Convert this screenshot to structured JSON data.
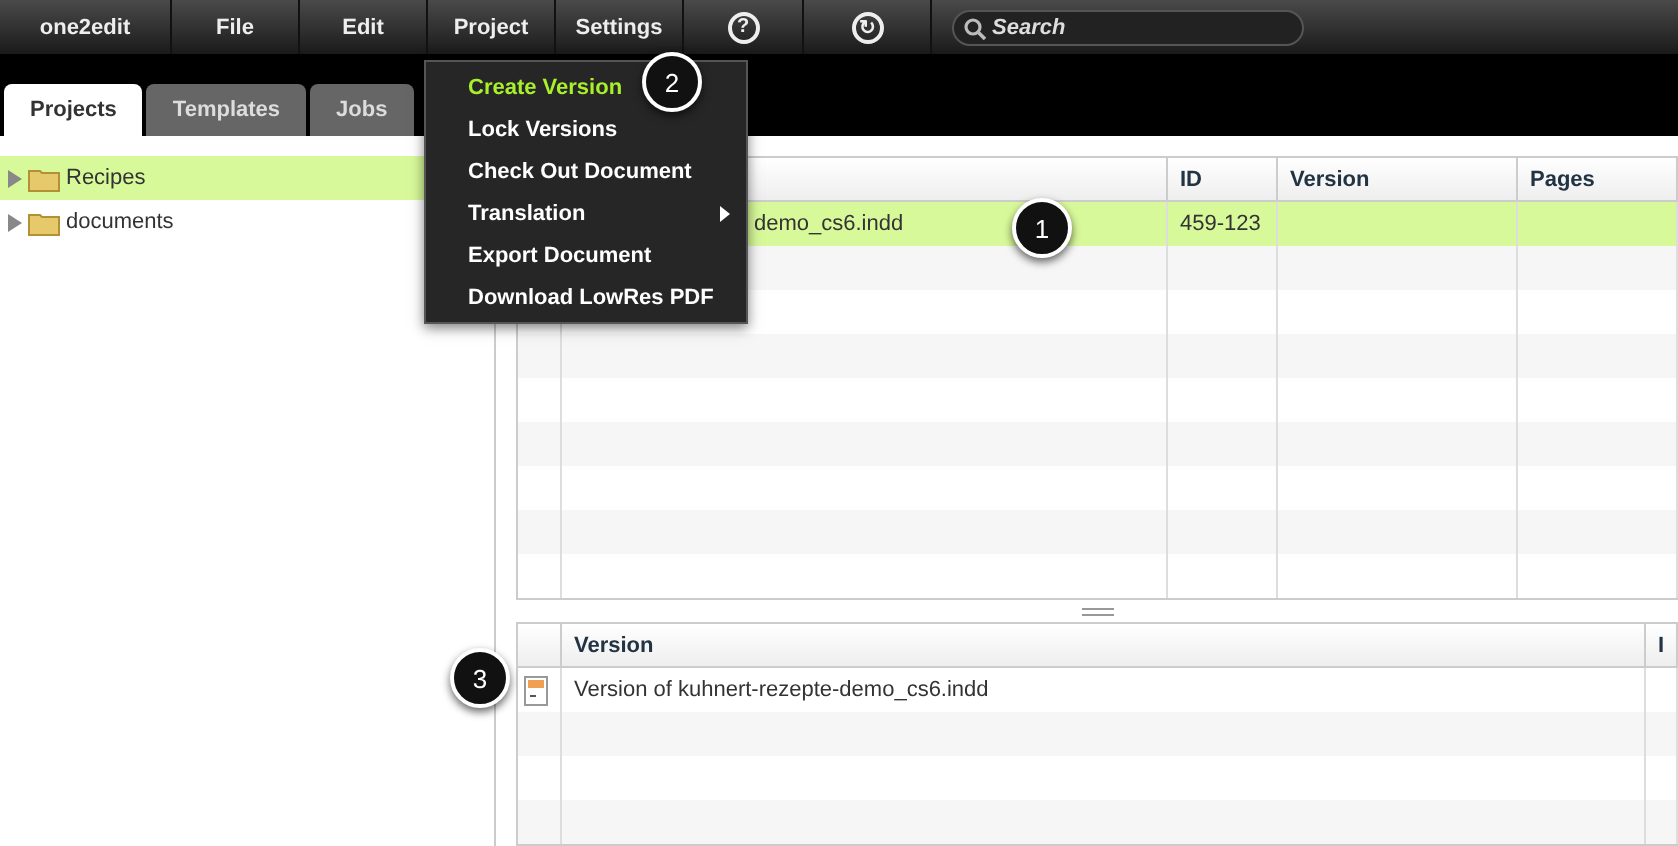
{
  "menubar": {
    "items": [
      {
        "label": "one2edit",
        "kind": "brand"
      },
      {
        "label": "File",
        "kind": "menu"
      },
      {
        "label": "Edit",
        "kind": "menu"
      },
      {
        "label": "Project",
        "kind": "menu"
      },
      {
        "label": "Settings",
        "kind": "menu"
      },
      {
        "label": "?",
        "kind": "help"
      },
      {
        "label": "↻",
        "kind": "refresh"
      }
    ],
    "search": {
      "placeholder": "Search"
    }
  },
  "tabs": [
    {
      "label": "Projects",
      "selected": true
    },
    {
      "label": "Templates",
      "selected": false
    },
    {
      "label": "Jobs",
      "selected": false
    }
  ],
  "tree": [
    {
      "label": "Recipes",
      "selected": true
    },
    {
      "label": "documents",
      "selected": false
    }
  ],
  "projects_table": {
    "columns": [
      "",
      "ID",
      "Version",
      "Pages"
    ],
    "rows": [
      {
        "cells": [
          "demo_cs6.indd",
          "459-123",
          "",
          ""
        ],
        "selected": true
      }
    ]
  },
  "versions_table": {
    "columns": [
      "Version",
      "I"
    ],
    "rows": [
      {
        "cells": [
          "Version of kuhnert-rezepte-demo_cs6.indd",
          ""
        ],
        "selected": false
      }
    ]
  },
  "dropdown": {
    "items": [
      {
        "label": "Create Version",
        "highlighted": true,
        "submenu": false
      },
      {
        "label": "Lock Versions",
        "highlighted": false,
        "submenu": false
      },
      {
        "label": "Check Out Document",
        "highlighted": false,
        "submenu": false
      },
      {
        "label": "Translation",
        "highlighted": false,
        "submenu": true
      },
      {
        "label": "Export Document",
        "highlighted": false,
        "submenu": false
      },
      {
        "label": "Download LowRes PDF",
        "highlighted": false,
        "submenu": false
      }
    ]
  },
  "callouts": [
    "1",
    "2",
    "3"
  ]
}
